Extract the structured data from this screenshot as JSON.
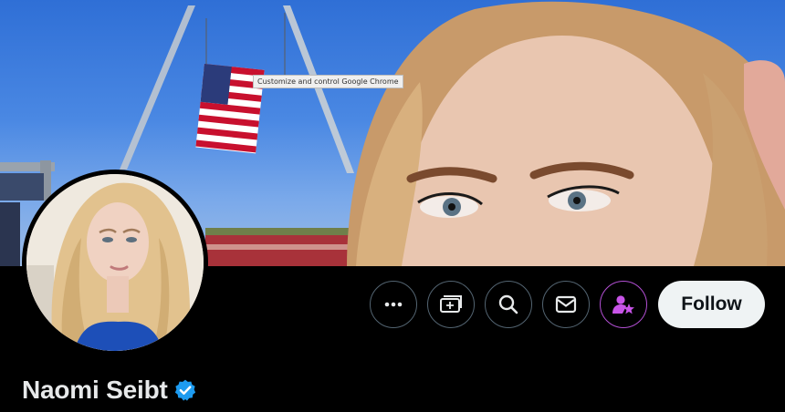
{
  "banner": {
    "tooltip_text": "Customize and control Google Chrome"
  },
  "profile": {
    "name": "Naomi Seibt",
    "verified": true,
    "verified_color": "#1d9bf0"
  },
  "actions": {
    "more_icon": "more-horizontal-icon",
    "grok_icon": "grok-icon",
    "search_icon": "search-icon",
    "message_icon": "envelope-icon",
    "subscribe_icon": "subscribe-person-star-icon",
    "subscribe_color": "#c854e8",
    "follow_label": "Follow"
  }
}
